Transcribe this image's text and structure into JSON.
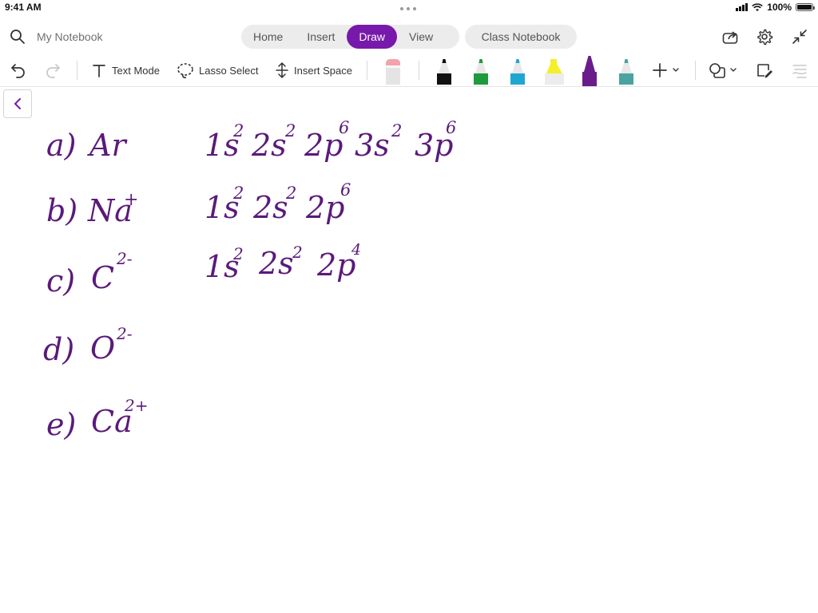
{
  "status_bar": {
    "time": "9:41 AM",
    "battery": "100%"
  },
  "header": {
    "notebook_name": "My Notebook",
    "tabs": [
      {
        "label": "Home",
        "active": false
      },
      {
        "label": "Insert",
        "active": false
      },
      {
        "label": "Draw",
        "active": true
      },
      {
        "label": "View",
        "active": false
      }
    ],
    "class_notebook_label": "Class Notebook"
  },
  "toolbar": {
    "text_mode_label": "Text Mode",
    "lasso_select_label": "Lasso Select",
    "insert_space_label": "Insert Space",
    "pens": [
      {
        "name": "eraser",
        "color": "#f2a3ad"
      },
      {
        "name": "black-pen",
        "color": "#111111"
      },
      {
        "name": "green-pen",
        "color": "#1f9a3c"
      },
      {
        "name": "cyan-pen",
        "color": "#1ea7d0"
      },
      {
        "name": "yellow-highlighter",
        "color": "#f5ef2a"
      },
      {
        "name": "purple-pen",
        "color": "#6a1d8a"
      },
      {
        "name": "teal-pen",
        "color": "#4aa3a0"
      }
    ]
  },
  "accent_color": "#7719aa",
  "ink_color": "#5a1a7a",
  "ink": {
    "labels": [
      "a)",
      "b)",
      "c)",
      "d)",
      "e)"
    ],
    "species": [
      "Ar",
      "Na",
      "C",
      "O",
      "Ca"
    ],
    "charges": [
      "",
      "+",
      "2-",
      "2-",
      "2+"
    ],
    "configs": [
      [
        [
          "1s",
          "2"
        ],
        [
          "2s",
          "2"
        ],
        [
          "2p",
          "6"
        ],
        [
          "3s",
          "2"
        ],
        [
          "3p",
          "6"
        ]
      ],
      [
        [
          "1s",
          "2"
        ],
        [
          "2s",
          "2"
        ],
        [
          "2p",
          "6"
        ]
      ],
      [
        [
          "1s",
          "2"
        ],
        [
          "2s",
          "2"
        ],
        [
          "2p",
          "4"
        ]
      ]
    ]
  }
}
